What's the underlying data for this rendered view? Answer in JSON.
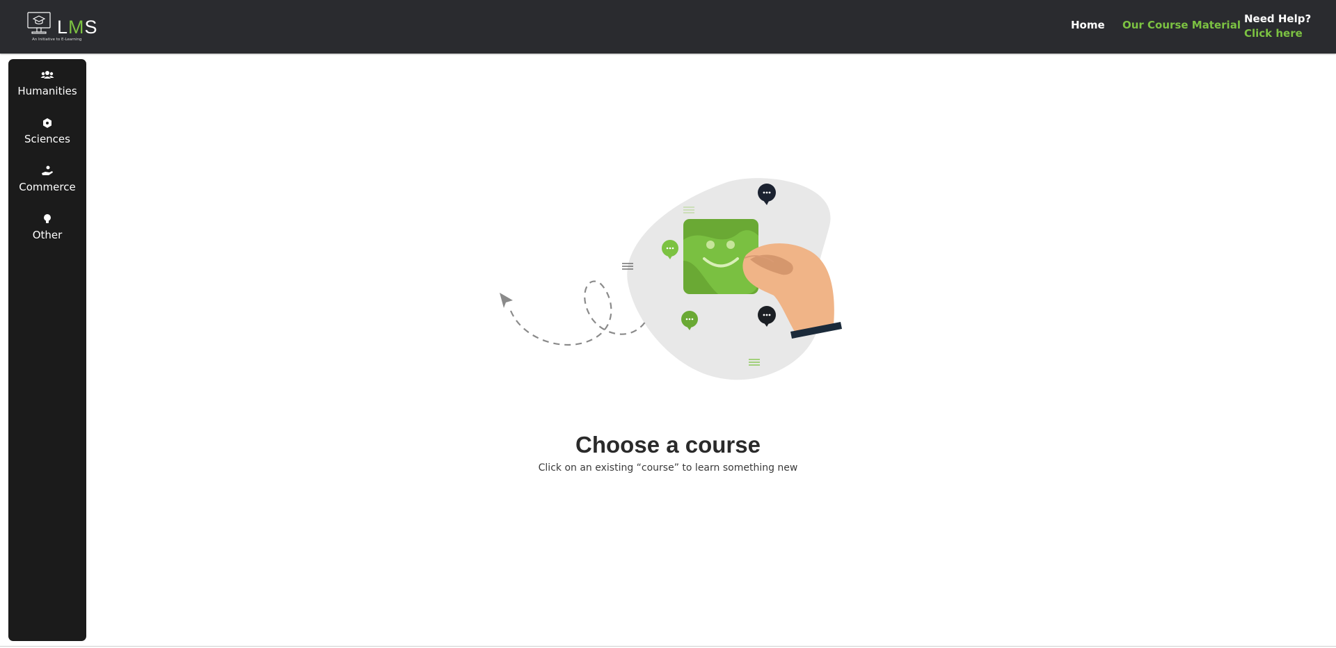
{
  "brand": {
    "name_part1": "L",
    "name_part2": "M",
    "name_part3": "S",
    "tagline": "An Initiative to E-Learning",
    "accent_color": "#7cc242"
  },
  "nav": {
    "home_label": "Home",
    "course_material_label": "Our Course Material",
    "help_title": "Need Help?",
    "help_link": "Click here"
  },
  "sidebar": {
    "items": [
      {
        "label": "Humanities",
        "icon": "users-icon"
      },
      {
        "label": "Sciences",
        "icon": "atom-icon"
      },
      {
        "label": "Commerce",
        "icon": "hand-coin-icon"
      },
      {
        "label": "Other",
        "icon": "lightbulb-icon"
      }
    ]
  },
  "main": {
    "title": "Choose a course",
    "subtitle": "Click on an existing “course” to learn something new",
    "illustration": "hand-holding-smiley-card-illustration"
  }
}
